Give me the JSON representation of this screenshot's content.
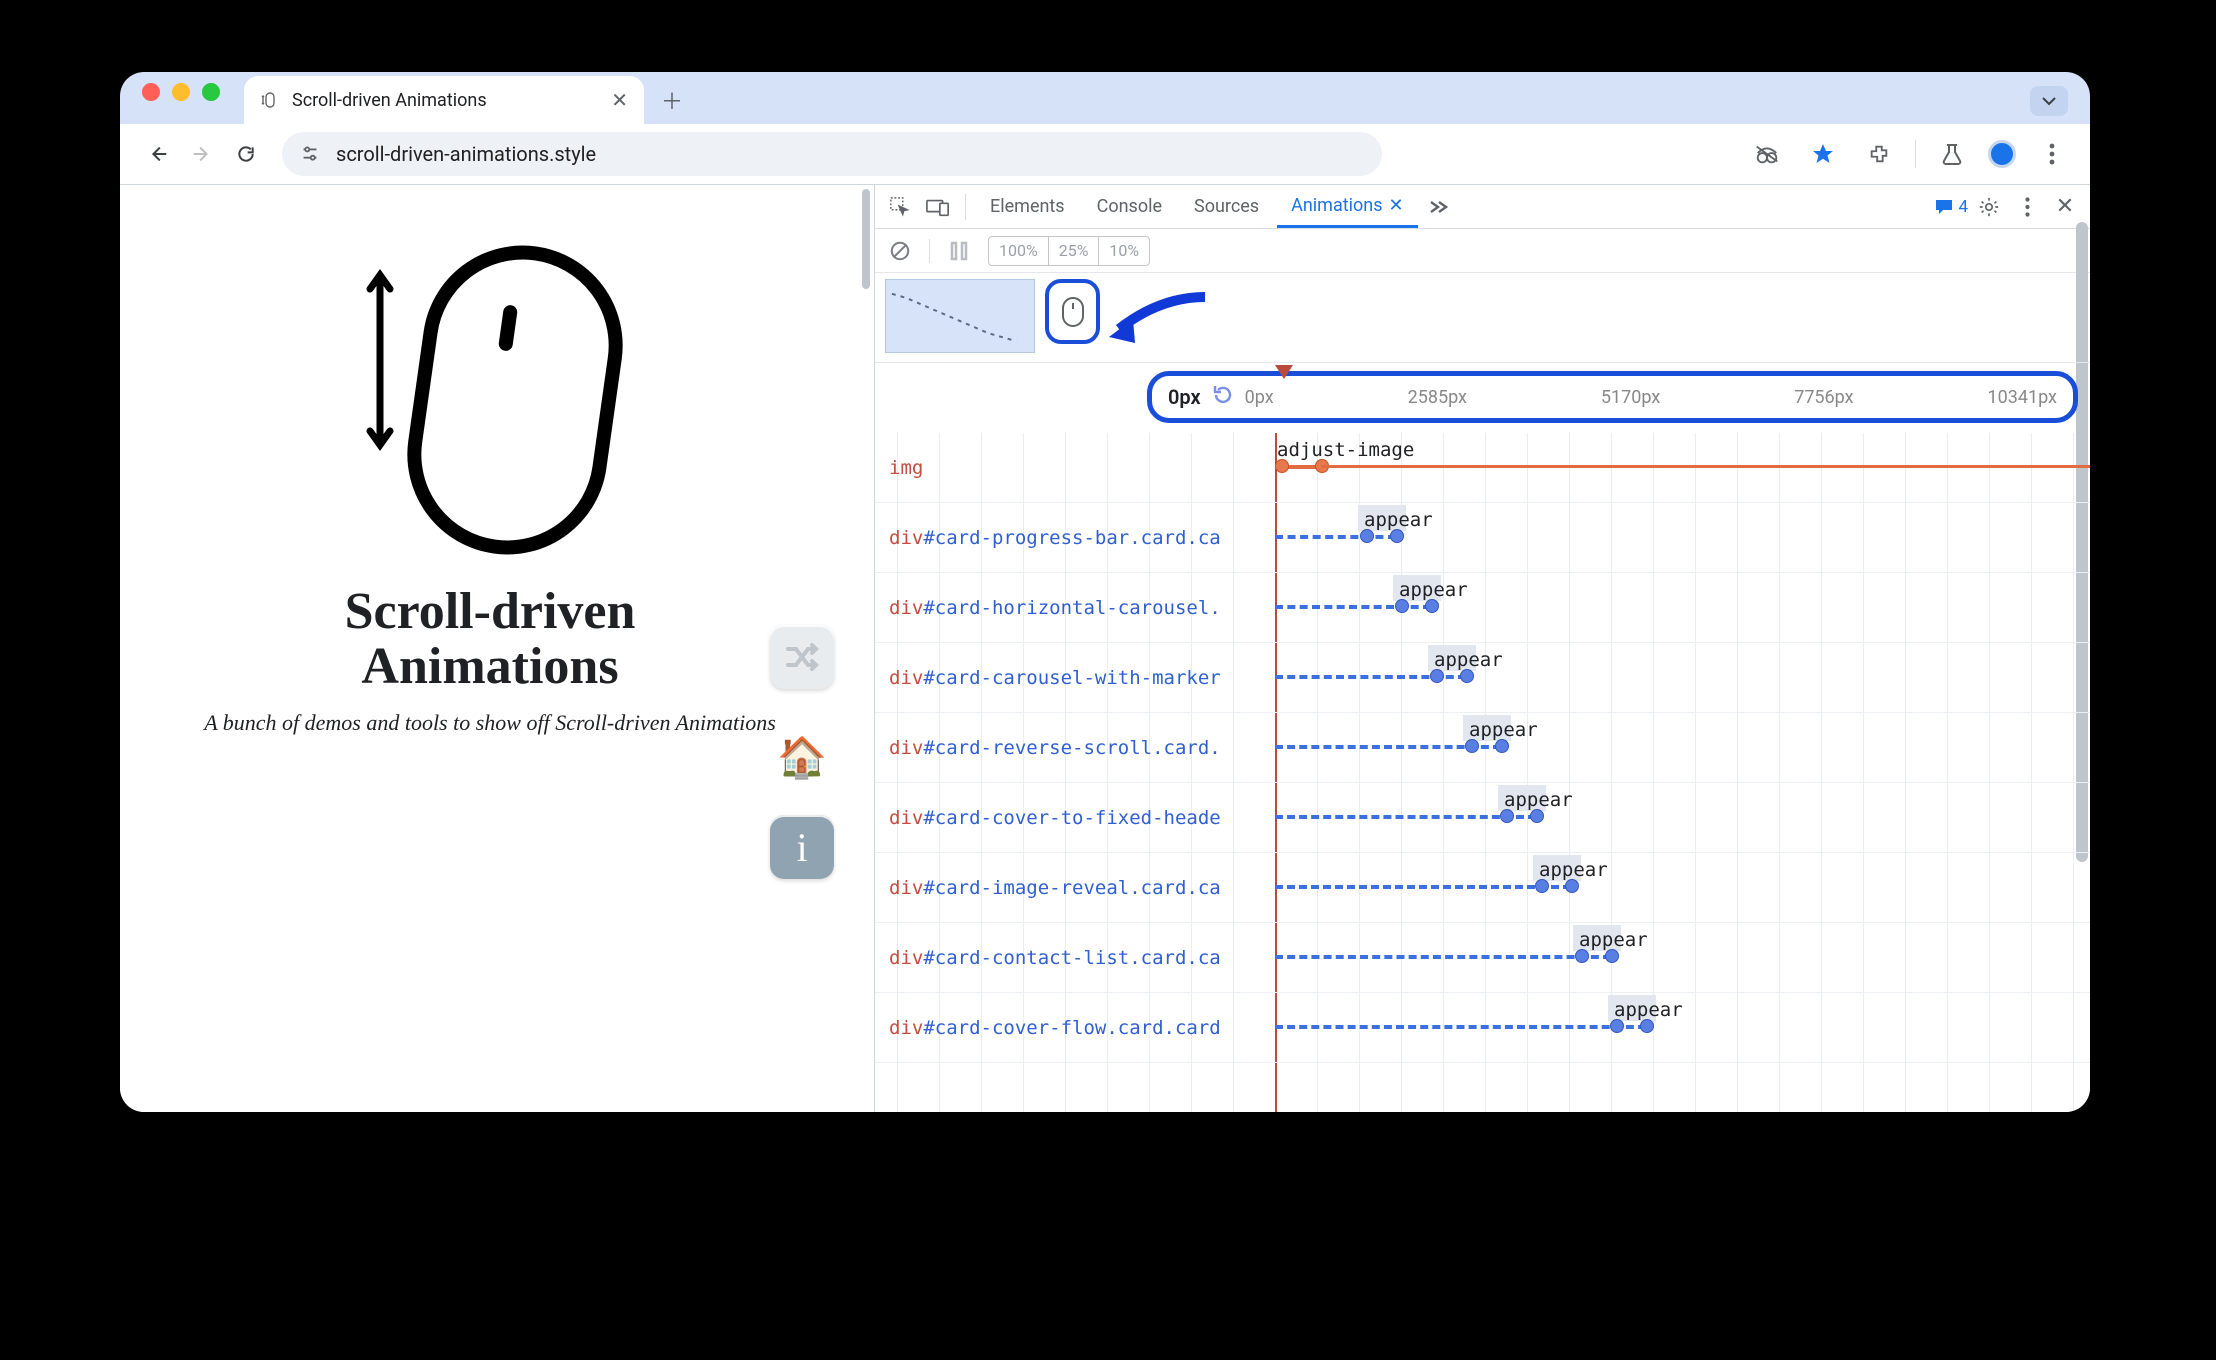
{
  "browser": {
    "tab_title": "Scroll-driven Animations",
    "url": "scroll-driven-animations.style"
  },
  "page": {
    "title_l1": "Scroll-driven",
    "title_l2": "Animations",
    "subtitle": "A bunch of demos and tools to show off Scroll-driven Animations"
  },
  "devtools": {
    "tabs": [
      "Elements",
      "Console",
      "Sources",
      "Animations"
    ],
    "active_tab": "Animations",
    "messages_count": "4",
    "speeds": [
      "100%",
      "25%",
      "10%"
    ],
    "ruler": {
      "current": "0px",
      "ticks": [
        "0px",
        "2585px",
        "5170px",
        "7756px",
        "10341px"
      ]
    },
    "tracks": [
      {
        "tag": "img",
        "id": "",
        "cls": "",
        "anim": "adjust-image",
        "offset": 0,
        "len": 40,
        "special": true
      },
      {
        "tag": "div",
        "id": "#card-progress-bar",
        "cls": ".card.ca",
        "anim": "appear",
        "offset": 85,
        "len": 30
      },
      {
        "tag": "div",
        "id": "#card-horizontal-carousel",
        "cls": ".",
        "anim": "appear",
        "offset": 120,
        "len": 30
      },
      {
        "tag": "div",
        "id": "#card-carousel-with-marker",
        "cls": "",
        "anim": "appear",
        "offset": 155,
        "len": 30
      },
      {
        "tag": "div",
        "id": "#card-reverse-scroll",
        "cls": ".card.",
        "anim": "appear",
        "offset": 190,
        "len": 30
      },
      {
        "tag": "div",
        "id": "#card-cover-to-fixed-heade",
        "cls": "",
        "anim": "appear",
        "offset": 225,
        "len": 30
      },
      {
        "tag": "div",
        "id": "#card-image-reveal",
        "cls": ".card.ca",
        "anim": "appear",
        "offset": 260,
        "len": 30
      },
      {
        "tag": "div",
        "id": "#card-contact-list",
        "cls": ".card.ca",
        "anim": "appear",
        "offset": 300,
        "len": 30
      },
      {
        "tag": "div",
        "id": "#card-cover-flow",
        "cls": ".card.card",
        "anim": "appear",
        "offset": 335,
        "len": 30
      }
    ]
  }
}
